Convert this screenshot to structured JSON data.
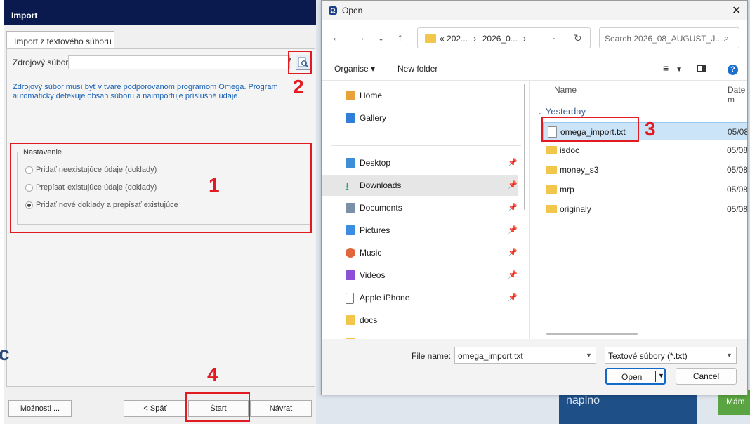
{
  "background": {
    "promo_text": "naplno",
    "green_text": "Mám",
    "left_letter": "c"
  },
  "import_dialog": {
    "title": "Import",
    "tab": "Import z textového súboru",
    "source_label": "Zdrojový súbor",
    "source_value": "",
    "info": "Zdrojový súbor musí byť v tvare podporovanom programom Omega. Program automaticky detekuje obsah súboru a naimportuje príslušné údaje.",
    "settings_title": "Nastavenie",
    "options": [
      {
        "label": "Pridať neexistujúce údaje (doklady)",
        "checked": false
      },
      {
        "label": "Prepísať existujúce údaje (doklady)",
        "checked": false
      },
      {
        "label": "Pridať nové doklady a prepísať existujúce",
        "checked": true
      }
    ],
    "buttons": {
      "options": "Možnosti ...",
      "back": "< Späť",
      "start": "Štart",
      "return": "Návrat"
    }
  },
  "annotations": {
    "n1": "1",
    "n2": "2",
    "n3": "3",
    "n4": "4",
    "color": "#e21b23"
  },
  "open_dialog": {
    "title": "Open",
    "address": [
      "«",
      "202...",
      "›",
      "2026_0...",
      "›"
    ],
    "search_placeholder": "Search 2026_08_AUGUST_J...",
    "organise": "Organise ▾",
    "new_folder": "New folder",
    "nav": [
      {
        "label": "Home",
        "icon": "home-icon",
        "color": "#e8a23a",
        "pinned": false
      },
      {
        "label": "Gallery",
        "icon": "gallery-icon",
        "color": "#2f7ed8",
        "pinned": false
      },
      {
        "label": "Desktop",
        "icon": "desktop-icon",
        "color": "#3e8ed7",
        "pinned": true
      },
      {
        "label": "Downloads",
        "icon": "download-icon",
        "color": "#2aa26a",
        "pinned": true,
        "selected": true
      },
      {
        "label": "Documents",
        "icon": "documents-icon",
        "color": "#7a8fa8",
        "pinned": true
      },
      {
        "label": "Pictures",
        "icon": "pictures-icon",
        "color": "#3b8de0",
        "pinned": true
      },
      {
        "label": "Music",
        "icon": "music-icon",
        "color": "#e0673b",
        "pinned": true
      },
      {
        "label": "Videos",
        "icon": "videos-icon",
        "color": "#8d4fd6",
        "pinned": true
      },
      {
        "label": "Apple iPhone",
        "icon": "phone-icon",
        "color": "#ffffff",
        "pinned": true
      },
      {
        "label": "docs",
        "icon": "docs-folder-icon",
        "color": "#5c4bb7",
        "pinned": false
      }
    ],
    "col_name": "Name",
    "col_date": "Date m",
    "group": "Yesterday",
    "files": [
      {
        "name": "omega_import.txt",
        "date": "05/08/",
        "type": "txt",
        "selected": true
      },
      {
        "name": "isdoc",
        "date": "05/08/",
        "type": "folder"
      },
      {
        "name": "money_s3",
        "date": "05/08/",
        "type": "folder"
      },
      {
        "name": "mrp",
        "date": "05/08/",
        "type": "folder"
      },
      {
        "name": "originaly",
        "date": "05/08/",
        "type": "folder"
      }
    ],
    "file_name_label": "File name:",
    "file_name_value": "omega_import.txt",
    "file_type": "Textové súbory (*.txt)",
    "open": "Open",
    "cancel": "Cancel"
  }
}
